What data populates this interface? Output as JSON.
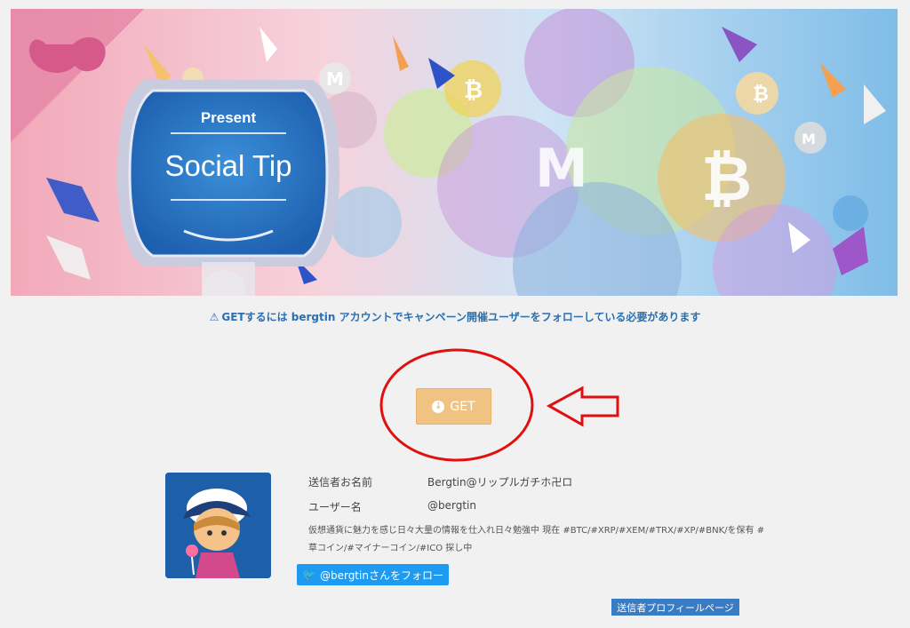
{
  "banner": {
    "present_text": "Present",
    "title_text": "Social Tip",
    "coin_btc": "B",
    "coin_mona": "M"
  },
  "notice": {
    "icon": "warning-triangle-icon",
    "text": "GETするには bergtin アカウントでキャンペーン開催ユーザーをフォローしている必要があります"
  },
  "get_button": {
    "icon": "download-circle-icon",
    "label": "GET"
  },
  "sender": {
    "name_label": "送信者お名前",
    "name_value": "Bergtin@リップルガチホ卍ロ",
    "username_label": "ユーザー名",
    "username_value": "@bergtin",
    "bio": "仮想通貨に魅力を感じ日々大量の情報を仕入れ日々勉強中 現在 #BTC/#XRP/#XEM/#TRX/#XP/#BNK/を保有 #草コイン/#マイナーコイン/#ICO 探し中",
    "follow_label": "@bergtinさんをフォロー",
    "follow_icon": "twitter-bird-icon",
    "profile_label": "送信者プロフィールページ"
  },
  "colors": {
    "accent_blue": "#2a6fb0",
    "get_orange": "#f0c383",
    "twitter_blue": "#1d9bf0",
    "annotation_red": "#e01010"
  }
}
